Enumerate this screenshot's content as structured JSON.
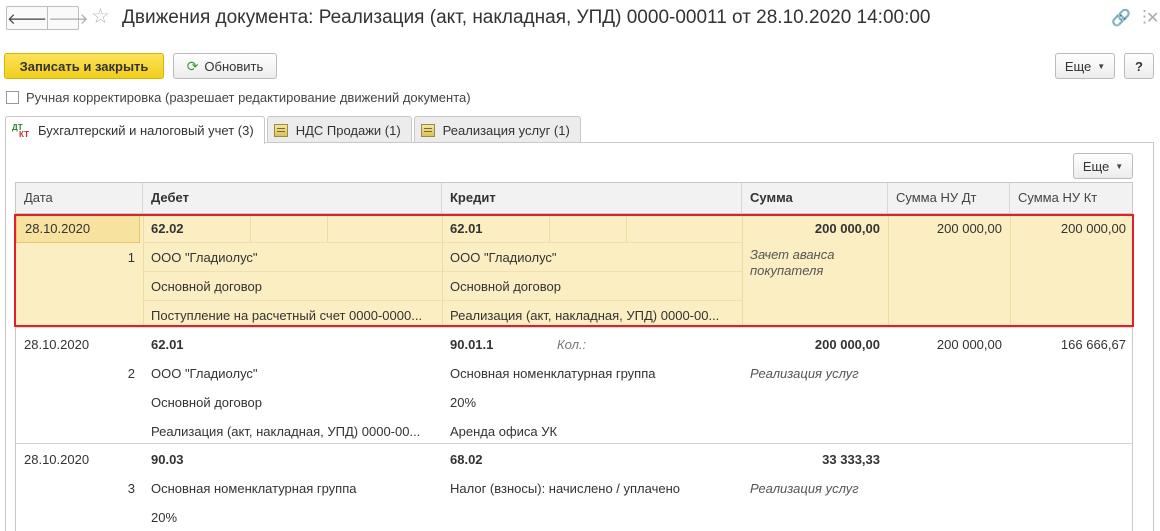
{
  "window": {
    "title": "Движения документа: Реализация (акт, накладная, УПД) 0000-00011 от 28.10.2020 14:00:00"
  },
  "toolbar": {
    "save_close": "Записать и закрыть",
    "refresh": "Обновить",
    "more": "Еще",
    "help": "?"
  },
  "checkbox": {
    "label": "Ручная корректировка (разрешает редактирование движений документа)",
    "checked": false
  },
  "tabs": [
    {
      "label": "Бухгалтерский и налоговый учет (3)",
      "active": true,
      "icon": "dt-kt-icon"
    },
    {
      "label": "НДС Продажи (1)",
      "active": false,
      "icon": "register-icon"
    },
    {
      "label": "Реализация услуг (1)",
      "active": false,
      "icon": "register-icon"
    }
  ],
  "grid_toolbar": {
    "more": "Еще"
  },
  "table": {
    "columns": [
      "Дата",
      "Дебет",
      "Кредит",
      "Сумма",
      "Сумма НУ Дт",
      "Сумма НУ Кт"
    ],
    "records": [
      {
        "date": "28.10.2020",
        "num": "1",
        "debit": [
          "62.02",
          "ООО \"Гладиолус\"",
          "Основной договор",
          "Поступление на расчетный счет 0000-0000..."
        ],
        "credit": [
          "62.01",
          "ООО \"Гладиолус\"",
          "Основной договор",
          "Реализация (акт, накладная, УПД) 0000-00..."
        ],
        "kol": "",
        "sum": "200 000,00",
        "content": "Зачет аванса покупателя",
        "nu_dt": "200 000,00",
        "nu_kt": "200 000,00"
      },
      {
        "date": "28.10.2020",
        "num": "2",
        "debit": [
          "62.01",
          "ООО \"Гладиолус\"",
          "Основной договор",
          "Реализация (акт, накладная, УПД) 0000-00..."
        ],
        "credit": [
          "90.01.1",
          "Основная номенклатурная группа",
          "20%",
          "Аренда офиса УК"
        ],
        "kol": "Кол.:",
        "sum": "200 000,00",
        "content": "Реализация услуг",
        "nu_dt": "200 000,00",
        "nu_kt": "166 666,67"
      },
      {
        "date": "28.10.2020",
        "num": "3",
        "debit": [
          "90.03",
          "Основная номенклатурная группа",
          "20%"
        ],
        "credit": [
          "68.02",
          "Налог (взносы): начислено / уплачено"
        ],
        "kol": "",
        "sum": "33 333,33",
        "content": "Реализация услуг",
        "nu_dt": "",
        "nu_kt": ""
      }
    ]
  },
  "colors": {
    "accent_yellow": "#f2cf1b",
    "selection": "#fbeec2",
    "highlight_border": "#e0202a"
  }
}
